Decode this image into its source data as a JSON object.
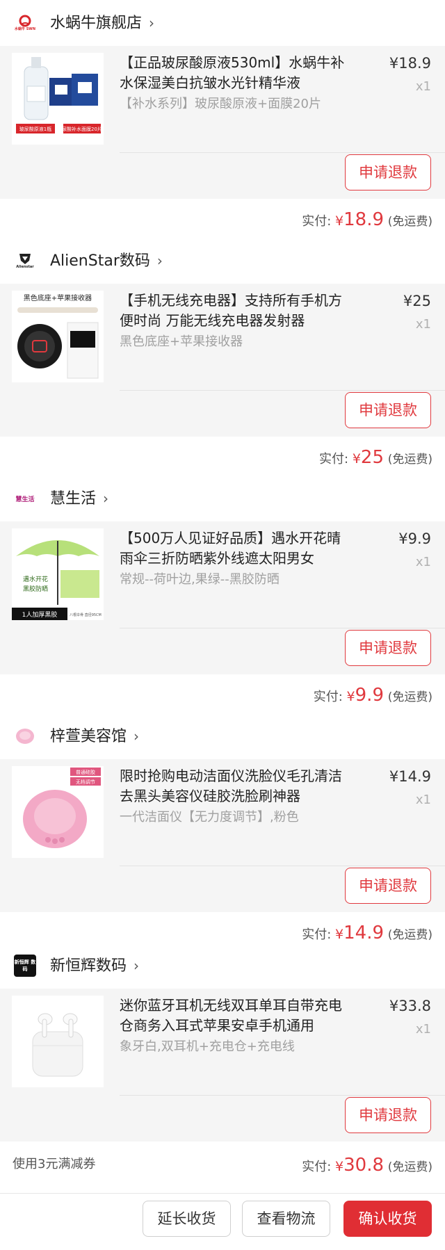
{
  "shops": [
    {
      "name": "水蜗牛旗舰店",
      "logo_text": "水蜗牛 SWN",
      "item": {
        "title": "【正品玻尿酸原液530ml】水蜗牛补水保湿美白抗皱水光针精华液",
        "spec": "【补水系列】玻尿酸原液+面膜20片",
        "price": "¥18.9",
        "qty": "x1",
        "thumb_labels": [
          "玻尿酸原液1瓶",
          "尿酸补水面膜20片"
        ]
      },
      "refund_label": "申请退款",
      "paid_label": "实付:",
      "paid_currency": "¥",
      "paid_amount": "18.9",
      "shipping": "(免运费)"
    },
    {
      "name": "AlienStar数码",
      "logo_text": "Alienstar",
      "item": {
        "title": "【手机无线充电器】支持所有手机方便时尚 万能无线充电器发射器",
        "spec": "黑色底座+苹果接收器",
        "price": "¥25",
        "qty": "x1",
        "thumb_labels": [
          "黑色底座+苹果接收器"
        ]
      },
      "refund_label": "申请退款",
      "paid_label": "实付:",
      "paid_currency": "¥",
      "paid_amount": "25",
      "shipping": "(免运费)"
    },
    {
      "name": "慧生活",
      "logo_text": "慧生活",
      "item": {
        "title": "【500万人见证好品质】遇水开花晴雨伞三折防晒紫外线遮太阳男女",
        "spec": "常规--荷叶边,果绿--黑胶防晒",
        "price": "¥9.9",
        "qty": "x1",
        "thumb_labels": [
          "遇水开花",
          "黑胶防晒",
          "1人加厚黑胶",
          "八根伞骨 直径95CM"
        ]
      },
      "refund_label": "申请退款",
      "paid_label": "实付:",
      "paid_currency": "¥",
      "paid_amount": "9.9",
      "shipping": "(免运费)"
    },
    {
      "name": "梓萱美容馆",
      "logo_text": "",
      "item": {
        "title": "限时抢购电动洁面仪洗脸仪毛孔清洁去黑头美容仪硅胶洗脸刷神器",
        "spec": "一代洁面仪【无力度调节】,粉色",
        "price": "¥14.9",
        "qty": "x1",
        "thumb_labels": [
          "普通硅胶",
          "无档调节"
        ]
      },
      "refund_label": "申请退款",
      "paid_label": "实付:",
      "paid_currency": "¥",
      "paid_amount": "14.9",
      "shipping": "(免运费)"
    },
    {
      "name": "新恒辉数码",
      "logo_text": "新恒辉 数码",
      "item": {
        "title": "迷你蓝牙耳机无线双耳单耳自带充电仓商务入耳式苹果安卓手机通用",
        "spec": "象牙白,双耳机+充电仓+充电线",
        "price": "¥33.8",
        "qty": "x1",
        "thumb_labels": []
      },
      "refund_label": "申请退款",
      "coupon": "使用3元满减券",
      "paid_label": "实付:",
      "paid_currency": "¥",
      "paid_amount": "30.8",
      "shipping": "(免运费)"
    }
  ],
  "bottom_bar": {
    "extend_label": "延长收货",
    "logistics_label": "查看物流",
    "confirm_label": "确认收货"
  },
  "colors": {
    "accent": "#e0393e",
    "primary_button": "#e02e34",
    "item_background": "#f5f5f5"
  }
}
